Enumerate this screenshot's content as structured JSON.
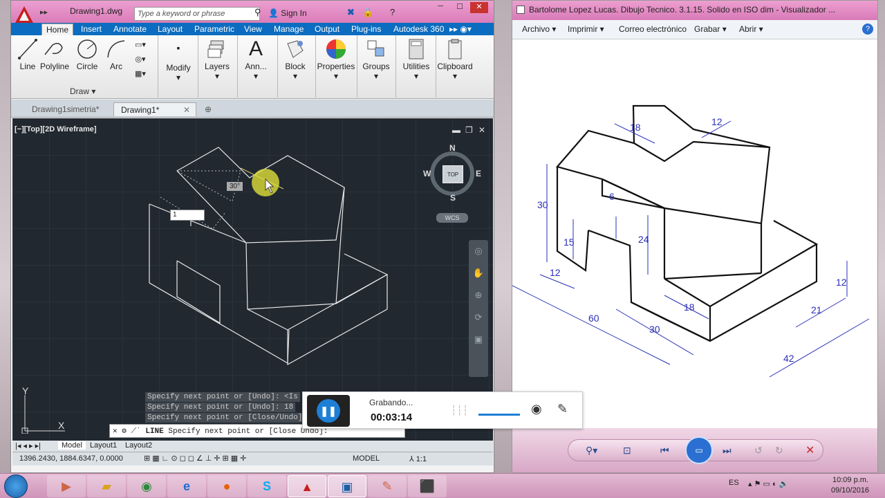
{
  "acad": {
    "doc_title": "Drawing1.dwg",
    "search_placeholder": "Type a keyword or phrase",
    "sign_in": "Sign In",
    "tabs": [
      "Home",
      "Insert",
      "Annotate",
      "Layout",
      "Parametric",
      "View",
      "Manage",
      "Output",
      "Plug-ins",
      "Autodesk 360"
    ],
    "draw_tools": [
      "Line",
      "Polyline",
      "Circle",
      "Arc"
    ],
    "draw_panel_label": "Draw",
    "panels": [
      "Modify",
      "Layers",
      "Ann...",
      "Block",
      "Properties",
      "Groups",
      "Utilities",
      "Clipboard"
    ],
    "doc_tabs": [
      "Drawing1simetria*",
      "Drawing1*"
    ],
    "viewport_label": "[−][Top][2D Wireframe]",
    "compass": {
      "n": "N",
      "s": "S",
      "e": "E",
      "w": "W",
      "center": "TOP",
      "wcs": "WCS"
    },
    "input_value": "1",
    "angle_tooltip": "30°",
    "ucs_y": "Y",
    "ucs_x": "X",
    "command_history": [
      "Specify next point or [Undo]:  <Is",
      "Specify next point or [Undo]: 18",
      "Specify next point or [Close/Undo]"
    ],
    "command_prefix": "LINE",
    "command_line": "Specify next point or [Close Undo]:",
    "layout_tabs": [
      "Model",
      "Layout1",
      "Layout2"
    ],
    "coords": "1396.2430, 1884.6347, 0.0000",
    "model_label": "MODEL",
    "scale": "1:1"
  },
  "viewer": {
    "title": "Bartolome Lopez Lucas. Dibujo Tecnico. 3.1.15. Solido en ISO dim - Visualizador ...",
    "menu": [
      "Archivo",
      "Imprimir",
      "Correo electrónico",
      "Grabar",
      "Abrir"
    ],
    "dims": [
      "18",
      "12",
      "30",
      "6",
      "15",
      "24",
      "12",
      "60",
      "30",
      "18",
      "21",
      "12",
      "42"
    ]
  },
  "recorder": {
    "status": "Grabando...",
    "time": "00:03:14"
  },
  "taskbar": {
    "lang": "ES",
    "time": "10:09 p.m.",
    "date": "09/10/2016"
  },
  "colors": {
    "ribbon_tab": "#0c6cbf",
    "canvas": "#212830",
    "title_pink": "#d97ab8",
    "dim_blue": "#2a2fb8",
    "recorder_blue": "#1e7fd6"
  }
}
